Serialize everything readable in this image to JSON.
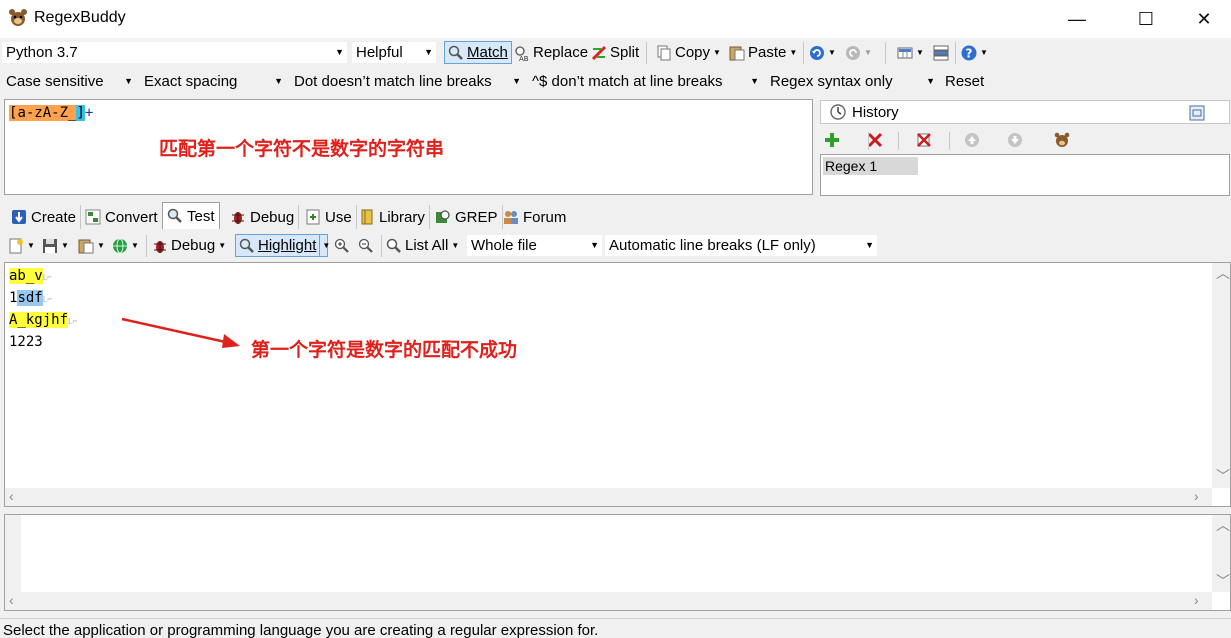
{
  "window": {
    "title": "RegexBuddy",
    "minimize": "—",
    "maximize": "☐",
    "close": "✕"
  },
  "toolbar1": {
    "flavor": "Python 3.7",
    "helpful": "Helpful",
    "match": "Match",
    "replace": "Replace",
    "split": "Split",
    "copy": "Copy",
    "paste": "Paste"
  },
  "toolbar2": {
    "case": "Case sensitive",
    "spacing": "Exact spacing",
    "dot": "Dot doesn’t match line breaks",
    "anchors": "^$ don’t match at line breaks",
    "syntax": "Regex syntax only",
    "reset": "Reset"
  },
  "regex": {
    "parts": [
      "[",
      "a-zA-Z_",
      "]",
      "+"
    ],
    "annotation": "匹配第一个字符不是数字的字符串"
  },
  "history": {
    "title": "History",
    "items": [
      "Regex 1"
    ]
  },
  "tabs": [
    "Create",
    "Convert",
    "Test",
    "Debug",
    "Use",
    "Library",
    "GREP",
    "Forum"
  ],
  "test_toolbar": {
    "debug": "Debug",
    "highlight": "Highlight",
    "list_all": "List All",
    "scope": "Whole file",
    "line_breaks": "Automatic line breaks (LF only)"
  },
  "test_lines": [
    {
      "prefix": "",
      "match": "ab_v",
      "suffix": ""
    },
    {
      "prefix": "1",
      "match": "sdf",
      "suffix": ""
    },
    {
      "prefix": "",
      "match": "A_kgjhf",
      "suffix": ""
    },
    {
      "prefix": "1223",
      "match": "",
      "suffix": ""
    }
  ],
  "test_annotation": "第一个字符是数字的匹配不成功",
  "status": "Select the application or programming language you are creating a regular expression for.",
  "colors": {
    "match_yellow": "#ffff3b",
    "match_blue": "#9ac7f0",
    "annotation_red": "#e0201b"
  }
}
